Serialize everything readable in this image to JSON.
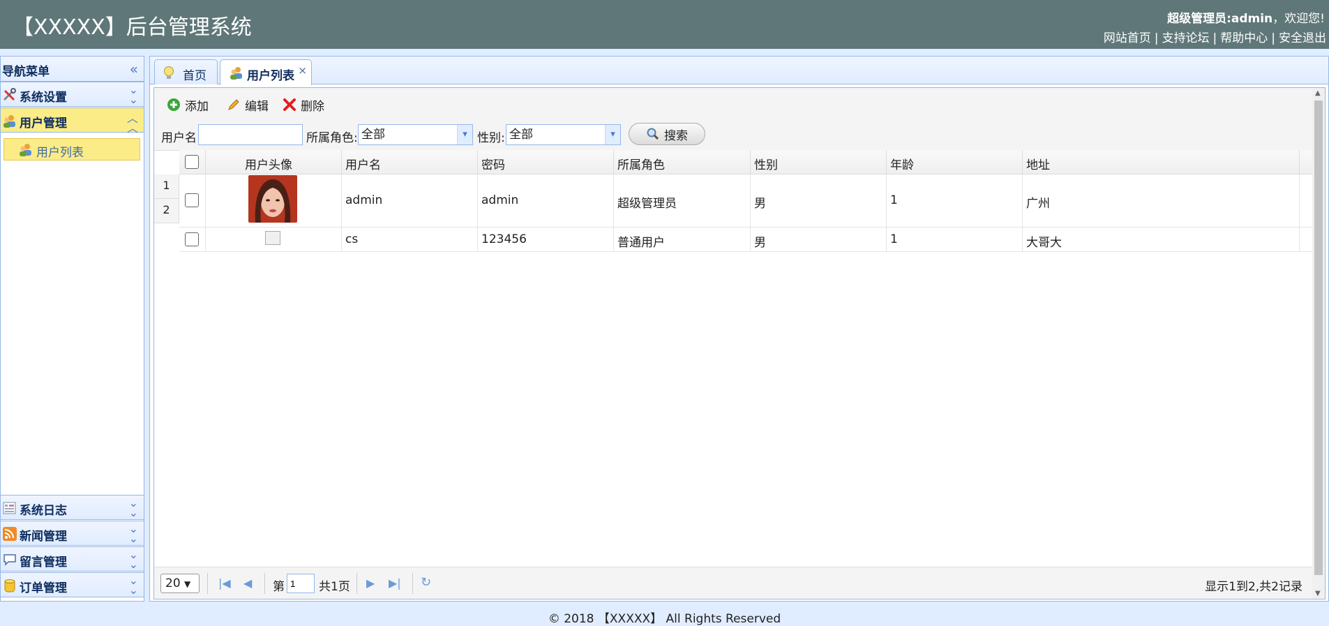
{
  "header": {
    "title": "【XXXXX】后台管理系统",
    "role": "超级管理员:admin",
    "welcome": "，欢迎您!",
    "links": [
      "网站首页",
      "支持论坛",
      "帮助中心",
      "安全退出"
    ]
  },
  "sidebar": {
    "title": "导航菜单",
    "groups": [
      {
        "label": "系统设置",
        "icon": "tools-icon"
      },
      {
        "label": "用户管理",
        "icon": "users-icon"
      },
      {
        "label": "系统日志",
        "icon": "log-icon"
      },
      {
        "label": "新闻管理",
        "icon": "rss-icon"
      },
      {
        "label": "留言管理",
        "icon": "comment-icon"
      },
      {
        "label": "订单管理",
        "icon": "database-icon"
      }
    ],
    "sub_item": "用户列表"
  },
  "tabs": [
    {
      "label": "首页",
      "icon": "lightbulb-icon"
    },
    {
      "label": "用户列表",
      "icon": "users-icon",
      "close": "×"
    }
  ],
  "toolbar": {
    "add": "添加",
    "edit": "编辑",
    "delete": "删除",
    "username_label": "用户名:",
    "username_value": "",
    "role_label": "所属角色:",
    "role_value": "全部",
    "gender_label": "性别:",
    "gender_value": "全部",
    "search": "搜索"
  },
  "grid": {
    "columns": [
      "用户头像",
      "用户名",
      "密码",
      "所属角色",
      "性别",
      "年龄",
      "地址"
    ],
    "row_numbers": [
      "1",
      "2"
    ],
    "rows": [
      {
        "username": "admin",
        "password": "admin",
        "role": "超级管理员",
        "gender": "男",
        "age": "1",
        "address": "广州"
      },
      {
        "username": "cs",
        "password": "123456",
        "role": "普通用户",
        "gender": "男",
        "age": "1",
        "address": "大哥大"
      }
    ]
  },
  "pager": {
    "page_size": "20",
    "page_prefix": "第",
    "page_value": "1",
    "page_total": "共1页",
    "info": "显示1到2,共2记录"
  },
  "footer": "© 2018 【XXXXX】 All Rights Reserved"
}
